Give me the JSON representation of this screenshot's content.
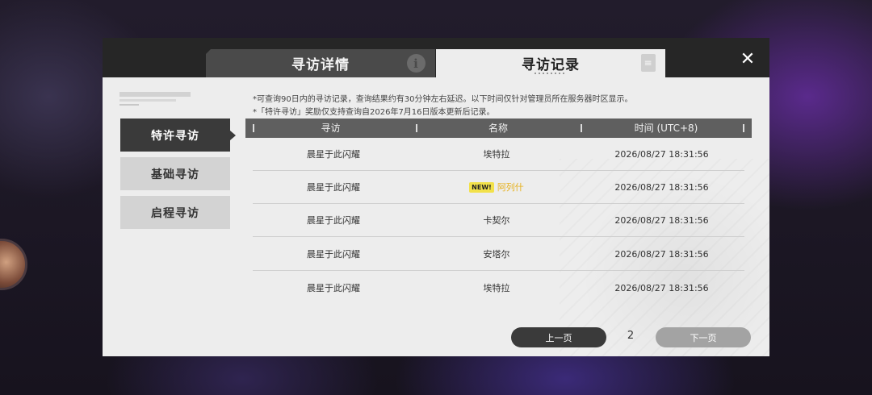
{
  "tabs": {
    "details": {
      "label": "寻访详情",
      "icon": "info-icon"
    },
    "records": {
      "label": "寻访记录",
      "icon": "document-icon"
    }
  },
  "close_icon": "close-icon",
  "sidebar": {
    "items": [
      {
        "label": "特许寻访",
        "active": true
      },
      {
        "label": "基础寻访",
        "active": false
      },
      {
        "label": "启程寻访",
        "active": false
      }
    ]
  },
  "notes": {
    "line1": "*可查询90日内的寻访记录，查询结果约有30分钟左右延迟。以下时间仅针对管理员所在服务器时区显示。",
    "line2": "*「特许寻访」奖励仅支持查询自2026年7月16日版本更新后记录。"
  },
  "table": {
    "headers": [
      "寻访",
      "名称",
      "时间 (UTC+8)"
    ],
    "rows": [
      {
        "pool": "晨星于此闪耀",
        "name": "埃特拉",
        "is_new": false,
        "time": "2026/08/27 18:31:56"
      },
      {
        "pool": "晨星于此闪耀",
        "name": "阿列什",
        "is_new": true,
        "new_label": "NEW!",
        "time": "2026/08/27 18:31:56"
      },
      {
        "pool": "晨星于此闪耀",
        "name": "卡契尔",
        "is_new": false,
        "time": "2026/08/27 18:31:56"
      },
      {
        "pool": "晨星于此闪耀",
        "name": "安塔尔",
        "is_new": false,
        "time": "2026/08/27 18:31:56"
      },
      {
        "pool": "晨星于此闪耀",
        "name": "埃特拉",
        "is_new": false,
        "time": "2026/08/27 18:31:56"
      }
    ]
  },
  "pager": {
    "prev_label": "上一页",
    "page": "2",
    "next_label": "下一页"
  },
  "colors": {
    "new_badge": "#f2e14a",
    "new_name": "#e6b01a",
    "active_tab": "#ededed",
    "header": "#262626"
  }
}
